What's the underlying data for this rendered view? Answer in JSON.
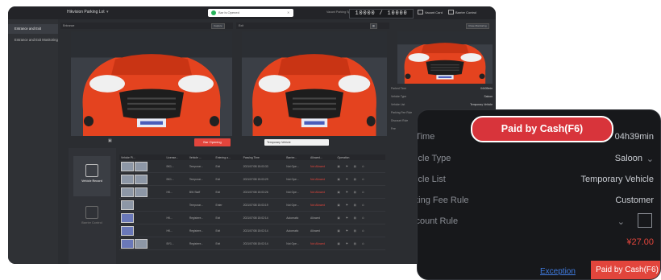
{
  "app": {
    "title": "Hikvision Parking Lot",
    "toast": "Bar Is Opened",
    "counter_label": "Vacant Parking Space",
    "counter": "10000 / 10000",
    "toolbar": {
      "vacant_card": "Vacant Card",
      "barrier_control": "Barrier Control"
    }
  },
  "sidebar": {
    "items": [
      {
        "label": "Entrance and Exit"
      },
      {
        "label": "Entrance and Exit Monitoring"
      }
    ]
  },
  "panels": {
    "entrance": {
      "label": "Entrance",
      "capture_label": "Capture"
    },
    "exit": {
      "label": "Exit"
    },
    "exit_button": "Close Monitoring",
    "red_button": "Bar Opening",
    "plate_value": "Temporary Vehicle"
  },
  "info_small": [
    {
      "label": "Parked Time",
      "value": "04h39min"
    },
    {
      "label": "Vehicle Type",
      "value": "Saloon"
    },
    {
      "label": "Vehicle List",
      "value": "Temporary Vehicle"
    },
    {
      "label": "Parking Fee Rule",
      "value": "Customer"
    },
    {
      "label": "Discount Rule",
      "value": ""
    },
    {
      "label": "Fee",
      "value": "¥27.00"
    }
  ],
  "left_panel": {
    "record": "Vehicle Record",
    "barrier": "Barrier Control"
  },
  "table": {
    "headers": [
      "Vehicle Pi...",
      "License...",
      "Vehicle ...",
      "Entering a...",
      "Passing Time",
      "Barrier... ",
      "Allowed...",
      "Operation"
    ],
    "rows": [
      {
        "c1": "BK1...",
        "c2": "Temporar...",
        "c3": "Exit",
        "c4": "2021/07/08 15:03:33",
        "c5": "Not Ope...",
        "c6": "Not Allowed",
        "red": true
      },
      {
        "c1": "BK1...",
        "c2": "Temporar...",
        "c3": "Exit",
        "c4": "2021/07/08 15:03:29",
        "c5": "Not Ope...",
        "c6": "Not Allowed",
        "red": true
      },
      {
        "c1": "HK...",
        "c2": "BW Staff",
        "c3": "Exit",
        "c4": "2021/07/08 15:03:26",
        "c5": "Not Ope...",
        "c6": "Not Allowed",
        "red": true
      },
      {
        "c1": "",
        "c2": "Temporar...",
        "c3": "Enter",
        "c4": "2021/07/08 15:03:19",
        "c5": "Not Ope...",
        "c6": "Not Allowed",
        "red": true
      },
      {
        "c1": "HK...",
        "c2": "Registere...",
        "c3": "Exit",
        "c4": "2021/07/08 15:02:14",
        "c5": "Automatic",
        "c6": "Allowed",
        "red": false
      },
      {
        "c1": "HK...",
        "c2": "Registere...",
        "c3": "Exit",
        "c4": "2021/07/08 15:02:14",
        "c5": "Automatic",
        "c6": "Allowed",
        "red": false
      },
      {
        "c1": "BY1...",
        "c2": "Registere...",
        "c3": "Exit",
        "c4": "2021/07/08 15:02:14",
        "c5": "Not Ope...",
        "c6": "Not Allowed",
        "red": true
      }
    ]
  },
  "zoom": {
    "rows": [
      {
        "label": "l Time",
        "value": "04h39min"
      },
      {
        "label": "hicle Type",
        "value": "Saloon"
      },
      {
        "label": "hicle List",
        "value": "Temporary Vehicle"
      },
      {
        "label": "rking Fee Rule",
        "value": "Customer"
      },
      {
        "label": "scount Rule",
        "value": ""
      },
      {
        "label": "e",
        "value": "¥27.00"
      }
    ],
    "exception": "Exception",
    "paid_button": "Paid by Cash(F6)",
    "badge": "Paid by Cash(F6)"
  },
  "colors": {
    "accent_red": "#e2453c",
    "link_blue": "#3f7be0"
  }
}
